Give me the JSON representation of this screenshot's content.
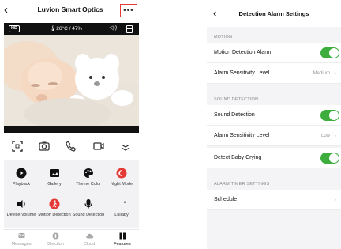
{
  "left": {
    "header": {
      "back": "‹",
      "title": "Luvion Smart Optics",
      "more": "•••"
    },
    "cam_bar": {
      "hd": "HD",
      "temp_humidity": "26°C / 47%",
      "speaker": "◁))"
    },
    "features": [
      {
        "label": "Playback",
        "icon": "play-icon",
        "color": "#111111"
      },
      {
        "label": "Gallery",
        "icon": "gallery-icon",
        "color": "#111111"
      },
      {
        "label": "Theme Color",
        "icon": "palette-icon",
        "color": "#111111"
      },
      {
        "label": "Night Mode",
        "icon": "night-mode-icon",
        "color": "#e53935"
      },
      {
        "label": "Device Volume",
        "icon": "volume-icon",
        "color": "#111111"
      },
      {
        "label": "Motion Detection",
        "icon": "motion-icon",
        "color": "#e53935"
      },
      {
        "label": "Sound Detection",
        "icon": "sound-icon",
        "color": "#111111"
      },
      {
        "label": "Lullaby",
        "icon": "lullaby-icon",
        "color": "#111111"
      }
    ],
    "tabs": [
      {
        "label": "Messages",
        "active": false
      },
      {
        "label": "Direction",
        "active": false
      },
      {
        "label": "Cloud",
        "active": false
      },
      {
        "label": "Features",
        "active": true
      }
    ]
  },
  "right": {
    "header": {
      "back": "‹",
      "title": "Detection Alarm Settings"
    },
    "motion": {
      "section": "MOTION",
      "alarm_label": "Motion Detection Alarm",
      "alarm_on": true,
      "sensitivity_label": "Alarm Sensitivity Level",
      "sensitivity_value": "Medium"
    },
    "sound": {
      "section": "SOUND DETECTION",
      "detection_label": "Sound Detection",
      "detection_on": true,
      "sensitivity_label": "Alarm Sensitivity Level",
      "sensitivity_value": "Low",
      "crying_label": "Detect Baby Crying",
      "crying_on": true
    },
    "timer": {
      "section": "ALARM TIMER SETTINGS",
      "schedule_label": "Schedule"
    },
    "chevron": "›"
  },
  "colors": {
    "toggle_on": "#3dae3d",
    "accent_red": "#e53935"
  }
}
